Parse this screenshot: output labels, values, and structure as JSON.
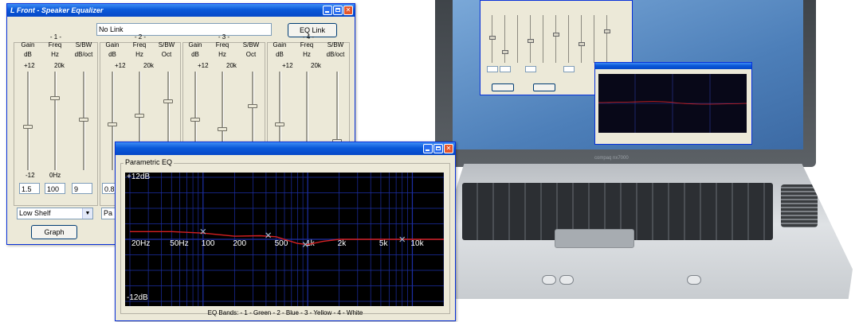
{
  "eq_window": {
    "title": "L Front - Speaker Equalizer",
    "link_field": "No Link",
    "eq_link_button": "EQ Link",
    "graph_button": "Graph",
    "bands": [
      {
        "number": "- 1 -",
        "headers": [
          "Gain",
          "Freq",
          "S/BW"
        ],
        "units": [
          "dB",
          "Hz",
          "dB/oct"
        ],
        "top_ticks": [
          "+12",
          "20k"
        ],
        "bottom_ticks": [
          "-12",
          "0Hz"
        ],
        "gain": "1.5",
        "freq": "100",
        "sbw": "9",
        "filter_type": "Low Shelf",
        "gain_level": 0.44,
        "freq_level": 0.73,
        "sbw_level": 0.52
      },
      {
        "number": "- 2 -",
        "headers": [
          "Gain",
          "Freq",
          "S/BW"
        ],
        "units": [
          "dB",
          "Hz",
          "Oct"
        ],
        "top_ticks": [
          "+12",
          "20k"
        ],
        "gain": "0.8",
        "filter_type": "Pa",
        "gain_level": 0.47,
        "freq_level": 0.56,
        "sbw_level": 0.7
      },
      {
        "number": "- 3 -",
        "headers": [
          "Gain",
          "Freq",
          "S/BW"
        ],
        "units": [
          "dB",
          "Hz",
          "Oct"
        ],
        "top_ticks": [
          "+12",
          "20k"
        ],
        "gain_level": 0.52,
        "freq_level": 0.42,
        "sbw_level": 0.65
      },
      {
        "number": "- 4 -",
        "headers": [
          "Gain",
          "Freq",
          "S/BW"
        ],
        "units": [
          "dB",
          "Hz",
          "dB/oct"
        ],
        "top_ticks": [
          "+12",
          "20k"
        ],
        "gain_level": 0.47,
        "freq_level": 0.1,
        "sbw_level": 0.3
      }
    ]
  },
  "peq_window": {
    "group_label": "Parametric EQ",
    "y_top": "+12dB",
    "y_bottom": "-12dB",
    "freq_labels": [
      {
        "label": "20Hz",
        "hz": 20
      },
      {
        "label": "50Hz",
        "hz": 50
      },
      {
        "label": "100",
        "hz": 100
      },
      {
        "label": "200",
        "hz": 200
      },
      {
        "label": "500",
        "hz": 500
      },
      {
        "label": "1k",
        "hz": 1000
      },
      {
        "label": "2k",
        "hz": 2000
      },
      {
        "label": "5k",
        "hz": 5000
      },
      {
        "label": "10k",
        "hz": 10000
      }
    ],
    "legend": "EQ Bands:  - 1 - Green  - 2 - Blue  - 3 - Yellow  - 4 - White",
    "curve_color": "#d62020",
    "grid_color": "#1c2fa6",
    "band_markers": [
      {
        "hz": 100,
        "db": 1.5
      },
      {
        "hz": 420,
        "db": 0.8
      },
      {
        "hz": 950,
        "db": -1.0
      },
      {
        "hz": 8000,
        "db": 0.0
      }
    ],
    "curve": [
      {
        "hz": 20,
        "db": 1.5
      },
      {
        "hz": 50,
        "db": 1.5
      },
      {
        "hz": 100,
        "db": 1.2
      },
      {
        "hz": 200,
        "db": 0.6
      },
      {
        "hz": 350,
        "db": 0.7
      },
      {
        "hz": 500,
        "db": 0.5
      },
      {
        "hz": 800,
        "db": -0.8
      },
      {
        "hz": 1000,
        "db": -1.0
      },
      {
        "hz": 1400,
        "db": -0.4
      },
      {
        "hz": 2000,
        "db": 0.0
      },
      {
        "hz": 5000,
        "db": 0.0
      },
      {
        "hz": 10000,
        "db": 0.0
      },
      {
        "hz": 20000,
        "db": 0.0
      }
    ]
  },
  "laptop": {
    "brand": "compaq nx7000"
  }
}
